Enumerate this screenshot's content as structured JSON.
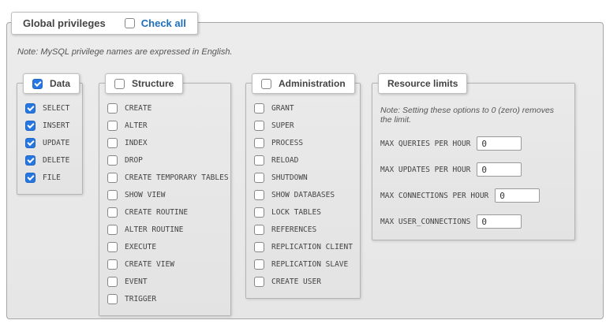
{
  "panel": {
    "title": "Global privileges",
    "check_all_label": "Check all",
    "check_all_checked": false,
    "note": "Note: MySQL privilege names are expressed in English."
  },
  "groups": [
    {
      "label": "Data",
      "checked": true,
      "items": [
        {
          "label": "SELECT",
          "checked": true
        },
        {
          "label": "INSERT",
          "checked": true
        },
        {
          "label": "UPDATE",
          "checked": true
        },
        {
          "label": "DELETE",
          "checked": true
        },
        {
          "label": "FILE",
          "checked": true
        }
      ]
    },
    {
      "label": "Structure",
      "checked": false,
      "items": [
        {
          "label": "CREATE",
          "checked": false
        },
        {
          "label": "ALTER",
          "checked": false
        },
        {
          "label": "INDEX",
          "checked": false
        },
        {
          "label": "DROP",
          "checked": false
        },
        {
          "label": "CREATE TEMPORARY TABLES",
          "checked": false
        },
        {
          "label": "SHOW VIEW",
          "checked": false
        },
        {
          "label": "CREATE ROUTINE",
          "checked": false
        },
        {
          "label": "ALTER ROUTINE",
          "checked": false
        },
        {
          "label": "EXECUTE",
          "checked": false
        },
        {
          "label": "CREATE VIEW",
          "checked": false
        },
        {
          "label": "EVENT",
          "checked": false
        },
        {
          "label": "TRIGGER",
          "checked": false
        }
      ]
    },
    {
      "label": "Administration",
      "checked": false,
      "items": [
        {
          "label": "GRANT",
          "checked": false
        },
        {
          "label": "SUPER",
          "checked": false
        },
        {
          "label": "PROCESS",
          "checked": false
        },
        {
          "label": "RELOAD",
          "checked": false
        },
        {
          "label": "SHUTDOWN",
          "checked": false
        },
        {
          "label": "SHOW DATABASES",
          "checked": false
        },
        {
          "label": "LOCK TABLES",
          "checked": false
        },
        {
          "label": "REFERENCES",
          "checked": false
        },
        {
          "label": "REPLICATION CLIENT",
          "checked": false
        },
        {
          "label": "REPLICATION SLAVE",
          "checked": false
        },
        {
          "label": "CREATE USER",
          "checked": false
        }
      ]
    }
  ],
  "resource_limits": {
    "label": "Resource limits",
    "note": "Note: Setting these options to 0 (zero) removes the limit.",
    "rows": [
      {
        "label": "MAX QUERIES PER HOUR",
        "value": "0"
      },
      {
        "label": "MAX UPDATES PER HOUR",
        "value": "0"
      },
      {
        "label": "MAX CONNECTIONS PER HOUR",
        "value": "0"
      },
      {
        "label": "MAX USER_CONNECTIONS",
        "value": "0"
      }
    ]
  },
  "colors": {
    "link_blue": "#1e6fbb",
    "checkbox_blue": "#2777e2",
    "fieldset_bg": "#e8e8e8",
    "border_gray": "#b4b4b4",
    "text_gray": "#444444"
  }
}
